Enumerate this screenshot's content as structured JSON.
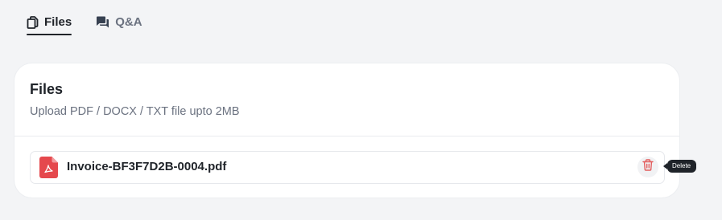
{
  "tabs": [
    {
      "label": "Files",
      "icon": "copy-files-icon",
      "active": true
    },
    {
      "label": "Q&A",
      "icon": "chat-bubbles-icon",
      "active": false
    }
  ],
  "card": {
    "title": "Files",
    "subtitle": "Upload PDF / DOCX / TXT file upto 2MB"
  },
  "files": [
    {
      "name": "Invoice-BF3F7D2B-0004.pdf",
      "type_icon": "pdf-file-icon"
    }
  ],
  "tooltip": {
    "delete": "Delete"
  },
  "colors": {
    "pdf_red": "#e5484d",
    "delete_red": "#e35d5d",
    "text_dark": "#1f2329",
    "text_muted": "#6b7280"
  }
}
